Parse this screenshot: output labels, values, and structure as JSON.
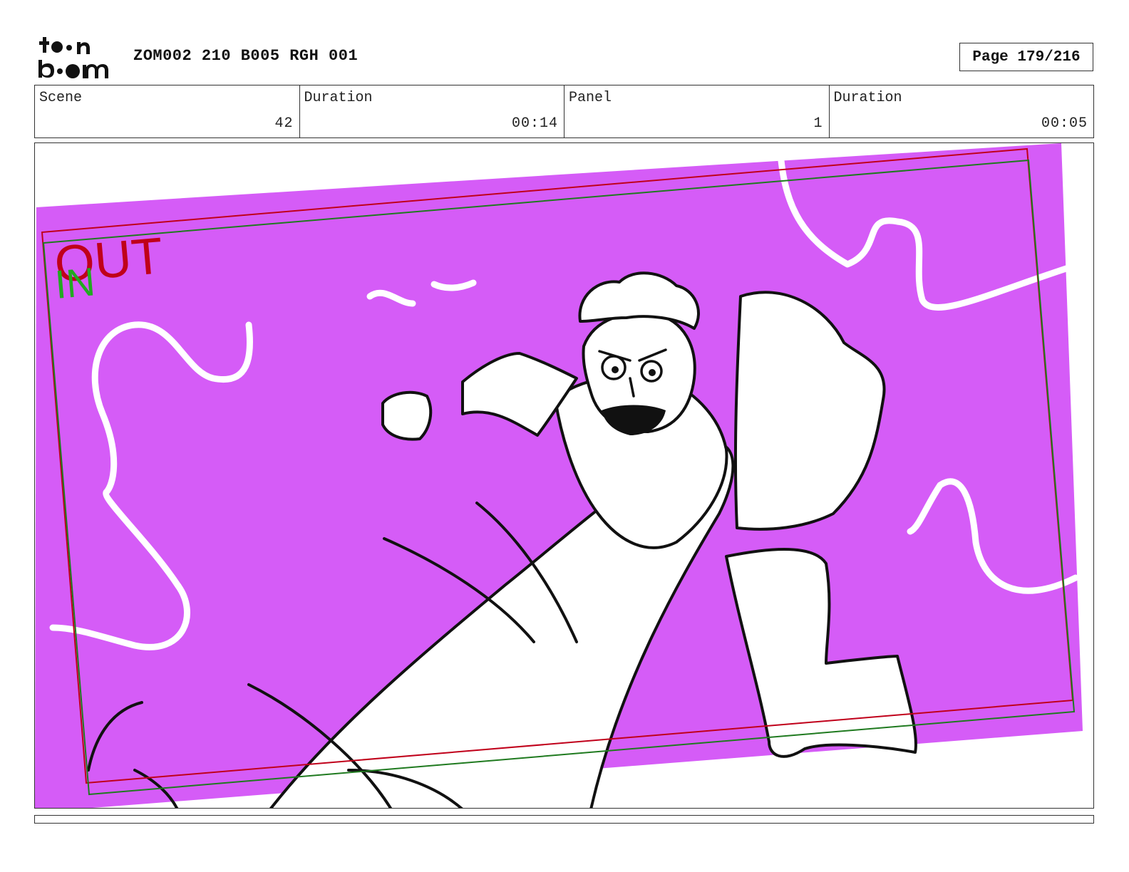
{
  "header": {
    "logo_text": "toon boom",
    "document_title": "ZOM002 210 B005 RGH 001",
    "page_indicator": "Page 179/216"
  },
  "info": {
    "scene_label": "Scene",
    "scene_value": "42",
    "scene_duration_label": "Duration",
    "scene_duration_value": "00:14",
    "panel_label": "Panel",
    "panel_value": "1",
    "panel_duration_label": "Duration",
    "panel_duration_value": "00:05"
  },
  "panel_frame": {
    "out_label": "OUT",
    "in_label": "IN",
    "out_color": "#c0001a",
    "in_color": "#22aa22",
    "background_color": "#d55cf7"
  }
}
